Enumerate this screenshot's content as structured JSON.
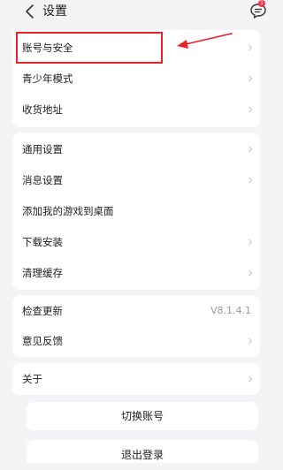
{
  "header": {
    "title": "设置",
    "back_icon": "chevron-left-icon",
    "message_icon": "chat-bubble-icon",
    "message_badge": "1"
  },
  "groups": [
    {
      "items": [
        {
          "label": "账号与安全",
          "chevron": true
        },
        {
          "label": "青少年模式",
          "chevron": true
        },
        {
          "label": "收货地址",
          "chevron": true
        }
      ]
    },
    {
      "items": [
        {
          "label": "通用设置",
          "chevron": true
        },
        {
          "label": "消息设置",
          "chevron": true
        },
        {
          "label": "添加我的游戏到桌面",
          "chevron": false
        },
        {
          "label": "下载安装",
          "chevron": true
        },
        {
          "label": "清理缓存",
          "chevron": true
        }
      ]
    },
    {
      "items": [
        {
          "label": "检查更新",
          "value": "V8.1.4.1",
          "chevron": false
        },
        {
          "label": "意见反馈",
          "chevron": true
        }
      ]
    },
    {
      "items": [
        {
          "label": "关于",
          "chevron": true
        }
      ]
    }
  ],
  "buttons": {
    "switch_account": "切换账号",
    "logout": "退出登录"
  },
  "annotation": {
    "highlight_color": "#e8222a"
  },
  "colors": {
    "background": "#f4f4f6",
    "card": "#ffffff",
    "badge": "#f5344c"
  }
}
